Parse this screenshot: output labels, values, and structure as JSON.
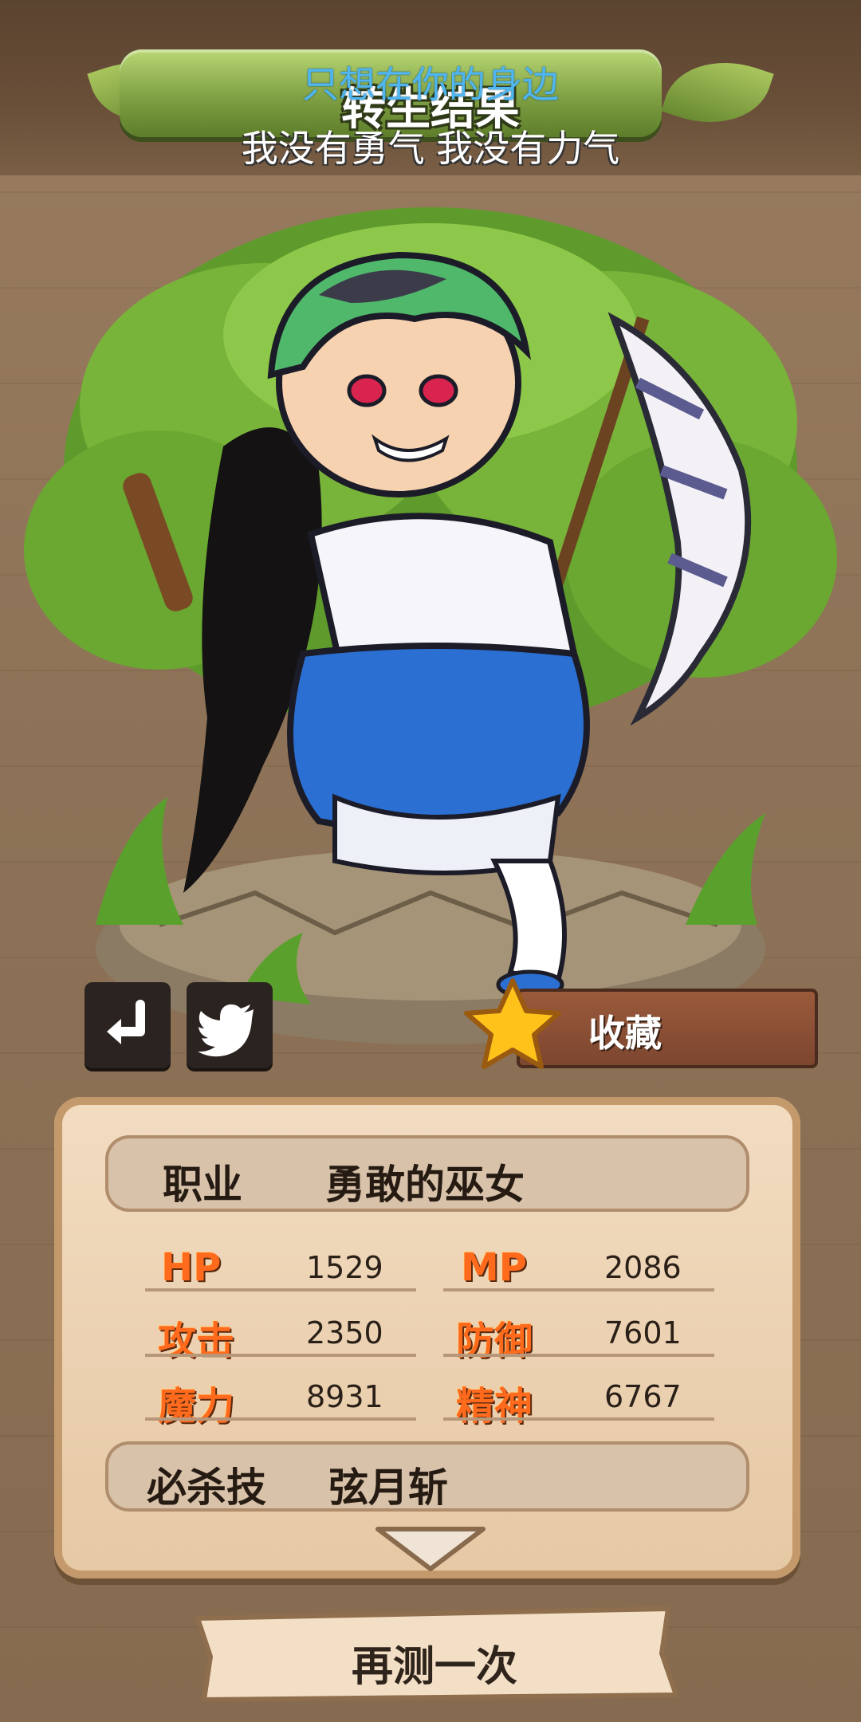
{
  "header": {
    "subtitle_line_1": "只想在你的身边",
    "title": "转生结果",
    "subtitle_line_2": "我没有勇气 我没有力气"
  },
  "actions": {
    "favorite_label": "收藏",
    "retry_label": "再测一次"
  },
  "profile": {
    "job_label": "职业",
    "job_value": "勇敢的巫女",
    "skill_label": "必杀技",
    "skill_value": "弦月斩"
  },
  "stats": {
    "hp_label": "HP",
    "hp": "1529",
    "mp_label": "MP",
    "mp": "2086",
    "atk_label": "攻击",
    "atk": "2350",
    "def_label": "防御",
    "def": "7601",
    "mag_label": "魔力",
    "mag": "8931",
    "spi_label": "精神",
    "spi": "6767"
  },
  "colors": {
    "title_banner": "#7fa043",
    "stat_label": "#ff6a1c",
    "panel": "#e6c8a4",
    "favorite_plank": "#9a5a3b"
  },
  "icons": [
    "back-icon",
    "twitter-icon",
    "star-icon",
    "chevron-down-icon"
  ]
}
